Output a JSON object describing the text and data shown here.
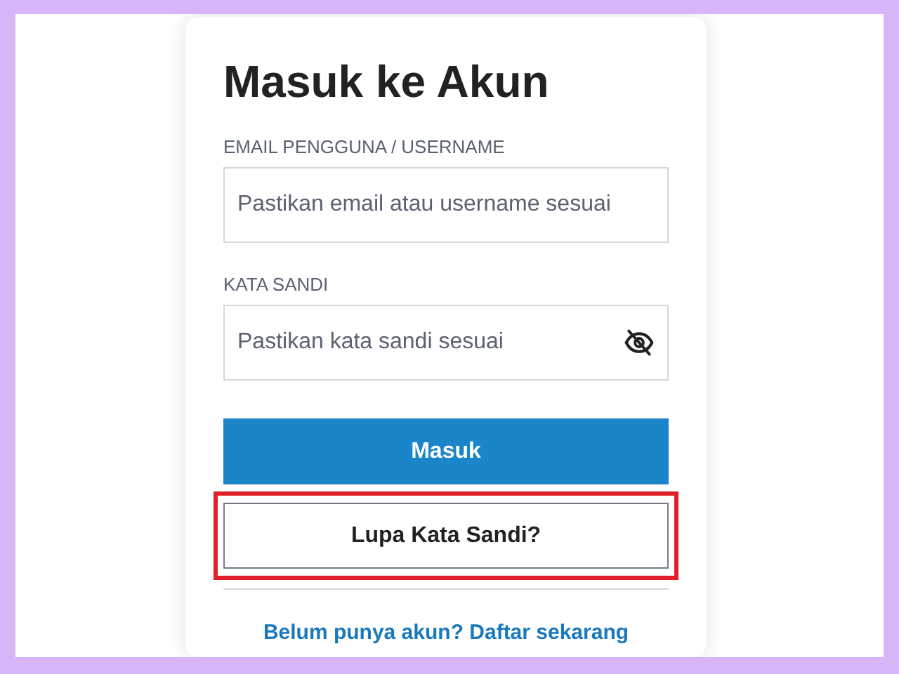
{
  "title": "Masuk ke Akun",
  "fields": [
    {
      "label": "EMAIL PENGGUNA / USERNAME",
      "placeholder": "Pastikan email atau username sesuai",
      "kind": "text"
    },
    {
      "label": "KATA SANDI",
      "placeholder": "Pastikan kata sandi sesuai",
      "kind": "password"
    }
  ],
  "buttons": [
    {
      "label": "Masuk",
      "kind": "primary",
      "highlighted": false
    },
    {
      "label": "Lupa Kata Sandi?",
      "kind": "secondary",
      "highlighted": true
    }
  ],
  "signup_link": "Belum punya akun? Daftar sekarang"
}
